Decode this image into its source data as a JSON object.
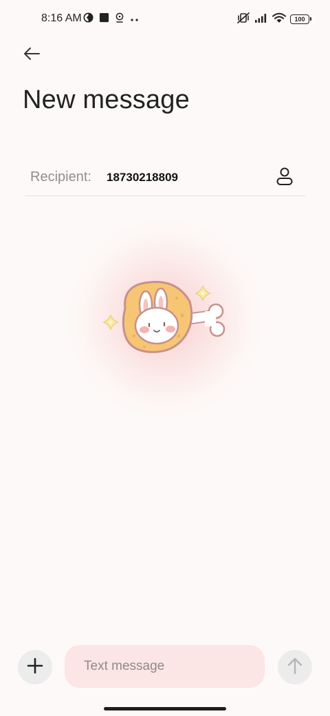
{
  "status_bar": {
    "time": "8:16 AM",
    "battery": "100",
    "left_icons": [
      "data-saver-icon",
      "square-notification-icon",
      "location-icon",
      "more-dots-icon"
    ],
    "right_icons": [
      "vibrate-off-icon",
      "signal-icon",
      "wifi-icon",
      "battery-icon"
    ]
  },
  "header": {
    "back_icon": "arrow-left-icon",
    "title": "New message"
  },
  "recipient": {
    "label": "Recipient:",
    "value": "18730218809",
    "contact_icon": "person-icon"
  },
  "illustration": {
    "name": "bunny-in-fried-drumstick"
  },
  "composer": {
    "add_icon": "plus-icon",
    "placeholder": "Text message",
    "send_icon": "arrow-up-icon"
  },
  "colors": {
    "background": "#fdf9f8",
    "input_bg": "#fbe5e5",
    "round_button_bg": "#ececec",
    "glow": "#f6bebe",
    "drumstick": "#f7c97a",
    "outline": "#c8908c"
  }
}
